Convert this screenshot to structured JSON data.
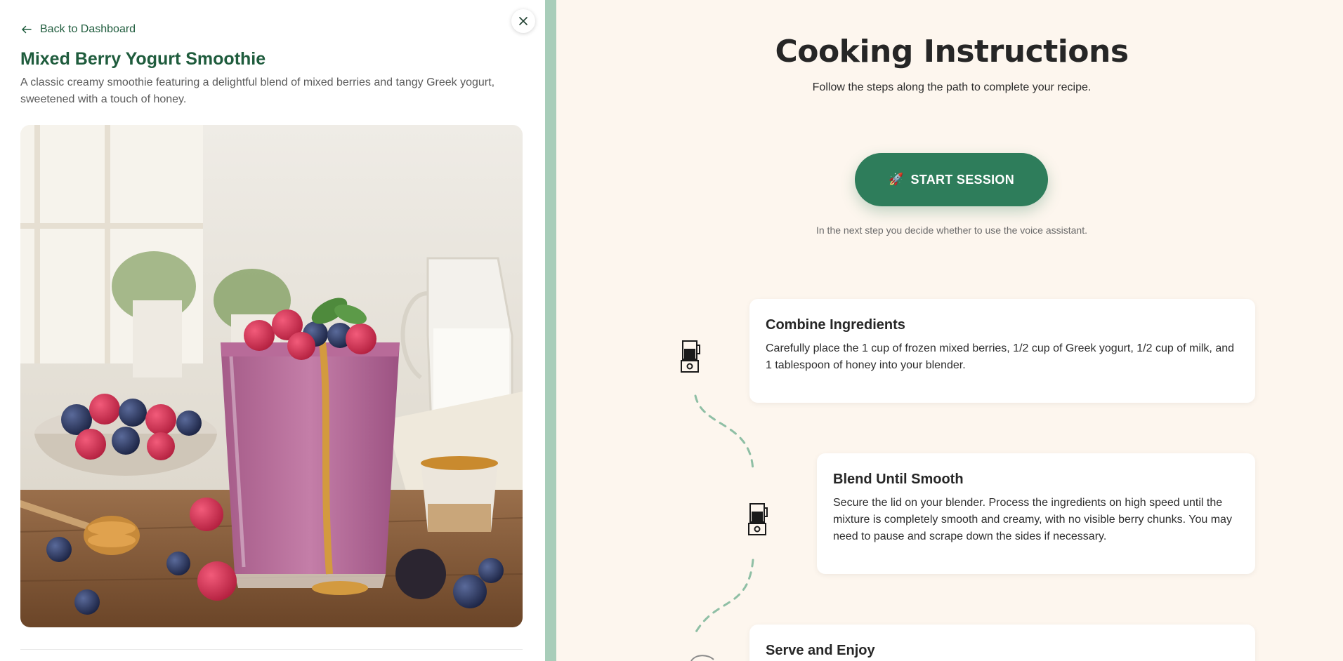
{
  "nav": {
    "back_label": "Back to Dashboard",
    "back_icon": "arrow-left-icon",
    "close_icon": "close-icon"
  },
  "recipe": {
    "title": "Mixed Berry Yogurt Smoothie",
    "description": "A classic creamy smoothie featuring a delightful blend of mixed berries and tangy Greek yogurt, sweetened with a touch of honey."
  },
  "instructions": {
    "title": "Cooking Instructions",
    "subtitle": "Follow the steps along the path to complete your recipe.",
    "start_button": {
      "icon": "🚀",
      "label": "START SESSION"
    },
    "start_note": "In the next step you decide whether to use the voice assistant.",
    "steps": [
      {
        "title": "Combine Ingredients",
        "text": "Carefully place the 1 cup of frozen mixed berries, 1/2 cup of Greek yogurt, 1/2 cup of milk, and 1 tablespoon of honey into your blender.",
        "icon": "blender-icon"
      },
      {
        "title": "Blend Until Smooth",
        "text": "Secure the lid on your blender. Process the ingredients on high speed until the mixture is completely smooth and creamy, with no visible berry chunks. You may need to pause and scrape down the sides if necessary.",
        "icon": "blender-icon"
      },
      {
        "title": "Serve and Enjoy",
        "text": "",
        "icon": "glass-icon"
      }
    ]
  },
  "colors": {
    "brand_green": "#1f5c3d",
    "button_green": "#2e7d5b",
    "separator_green": "#a8cdb9",
    "background_cream": "#fdf6ee"
  }
}
